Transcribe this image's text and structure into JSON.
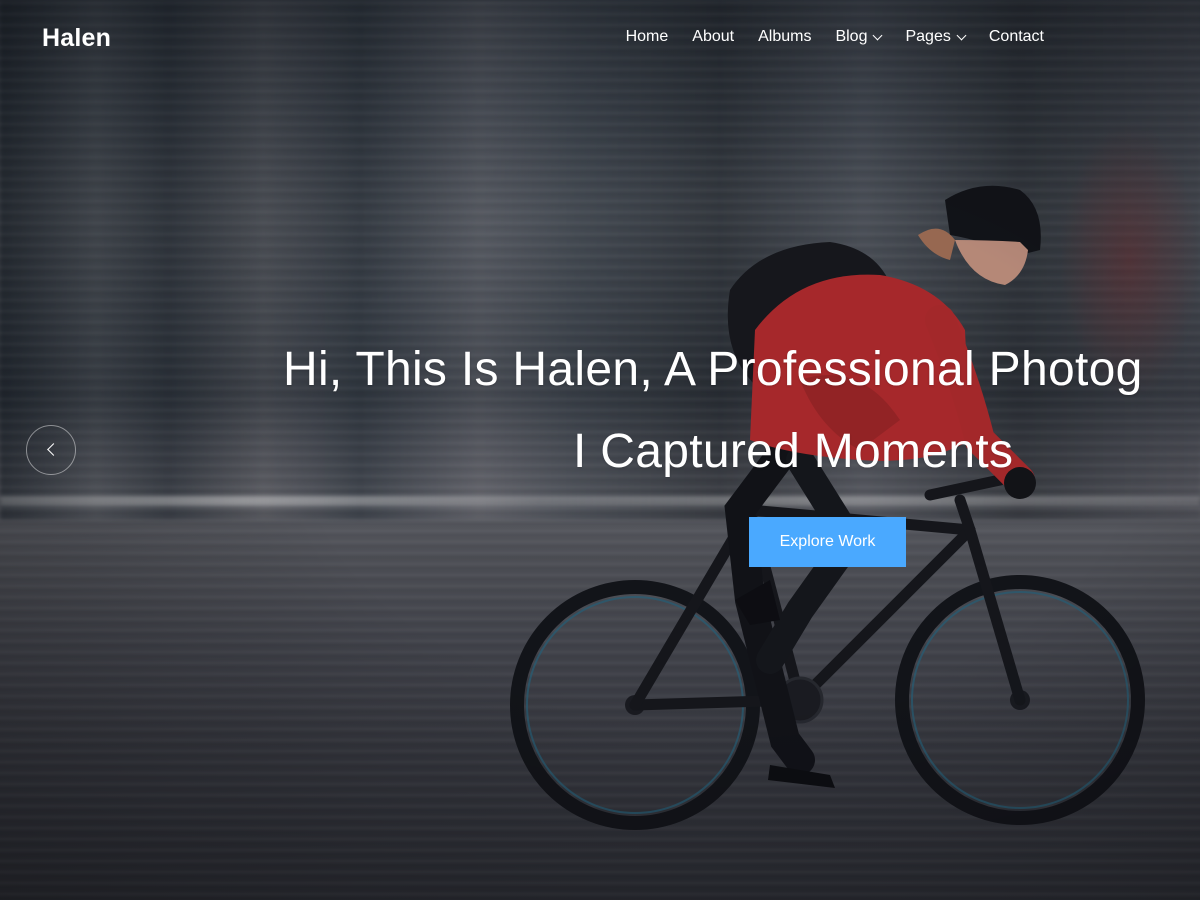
{
  "site": {
    "logo": "Halen"
  },
  "nav": {
    "items": [
      {
        "label": "Home",
        "has_dropdown": false
      },
      {
        "label": "About",
        "has_dropdown": false
      },
      {
        "label": "Albums",
        "has_dropdown": false
      },
      {
        "label": "Blog",
        "has_dropdown": true
      },
      {
        "label": "Pages",
        "has_dropdown": true
      },
      {
        "label": "Contact",
        "has_dropdown": false
      }
    ]
  },
  "hero": {
    "headline_line1": "Hi, This Is Halen, A Professional Photog",
    "headline_line2": "I Captured Moments",
    "cta_label": "Explore Work",
    "prev_icon": "chevron-left-icon"
  },
  "colors": {
    "accent": "#4aa9ff",
    "text": "#ffffff"
  }
}
